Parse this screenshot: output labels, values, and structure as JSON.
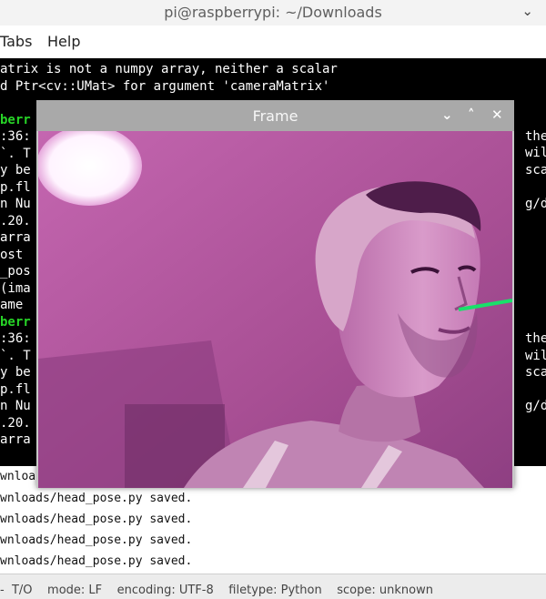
{
  "terminal": {
    "title": "pi@raspberrypi: ~/Downloads",
    "chevron": "⌄",
    "menu": [
      "Tabs",
      "Help"
    ],
    "lines": [
      {
        "text": "atrix is not a numpy array, neither a scalar",
        "color": "white"
      },
      {
        "text": "d Ptr<cv::UMat> for argument 'cameraMatrix'",
        "color": "white"
      },
      {
        "text": "",
        "color": "white"
      },
      {
        "text": "berr",
        "color": "green"
      },
      {
        "text": ":36:",
        "color": "white"
      },
      {
        "text": "`. T",
        "color": "white"
      },
      {
        "text": "y be",
        "color": "white"
      },
      {
        "text": "p.fl",
        "color": "white"
      },
      {
        "text": "n Nu",
        "color": "white"
      },
      {
        "text": ".20.",
        "color": "white"
      },
      {
        "text": "arra",
        "color": "white"
      },
      {
        "text": "ost ",
        "color": "white"
      },
      {
        "text": "_pos",
        "color": "white"
      },
      {
        "text": "(ima",
        "color": "white"
      },
      {
        "text": "ame ",
        "color": "white"
      },
      {
        "text": "berr",
        "color": "green"
      },
      {
        "text": ":36:",
        "color": "white"
      },
      {
        "text": "`. T",
        "color": "white"
      },
      {
        "text": "y be",
        "color": "white"
      },
      {
        "text": "p.fl",
        "color": "white"
      },
      {
        "text": "n Nu",
        "color": "white"
      },
      {
        "text": ".20.",
        "color": "white"
      },
      {
        "text": "arra",
        "color": "white"
      }
    ],
    "right_fragments": [
      "the",
      "wil",
      "scal",
      "g/de",
      "the",
      "wil",
      "scal",
      "g/de"
    ]
  },
  "output": {
    "lines": [
      "wnloa",
      "wnloads/head_pose.py saved.",
      "wnloads/head_pose.py saved.",
      "wnloads/head_pose.py saved.",
      "wnloads/head_pose.py saved."
    ]
  },
  "statusbar": {
    "text": "-  T/O    mode: LF    encoding: UTF-8    filetype: Python    scope: unknown"
  },
  "frame_window": {
    "title": "Frame",
    "buttons": {
      "minimize": "⌄",
      "maximize": "˄",
      "close": "✕"
    }
  },
  "colors": {
    "camera_tint": "#b2569b",
    "pose_line": "#19e06a",
    "terminal_green": "#27d427"
  }
}
